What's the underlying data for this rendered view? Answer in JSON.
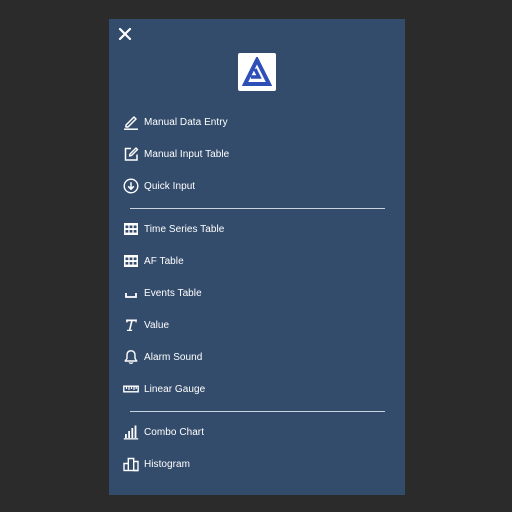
{
  "menu": {
    "items": [
      {
        "label": "Manual Data Entry",
        "icon": "pencil-icon"
      },
      {
        "label": "Manual Input Table",
        "icon": "edit-square-icon"
      },
      {
        "label": "Quick Input",
        "icon": "circle-arrow-down-icon"
      },
      {
        "label": "Time Series Table",
        "icon": "table-grid-icon"
      },
      {
        "label": "AF Table",
        "icon": "table-grid-icon"
      },
      {
        "label": "Events Table",
        "icon": "bracket-icon"
      },
      {
        "label": "Value",
        "icon": "text-t-icon"
      },
      {
        "label": "Alarm Sound",
        "icon": "bell-icon"
      },
      {
        "label": "Linear Gauge",
        "icon": "ruler-icon"
      },
      {
        "label": "Combo Chart",
        "icon": "bar-chart-icon"
      },
      {
        "label": "Histogram",
        "icon": "histogram-icon"
      }
    ]
  },
  "colors": {
    "background": "#2b2b2b",
    "panel": "#344c6c",
    "text": "#ffffff",
    "logo_accent": "#2f4fb8"
  }
}
